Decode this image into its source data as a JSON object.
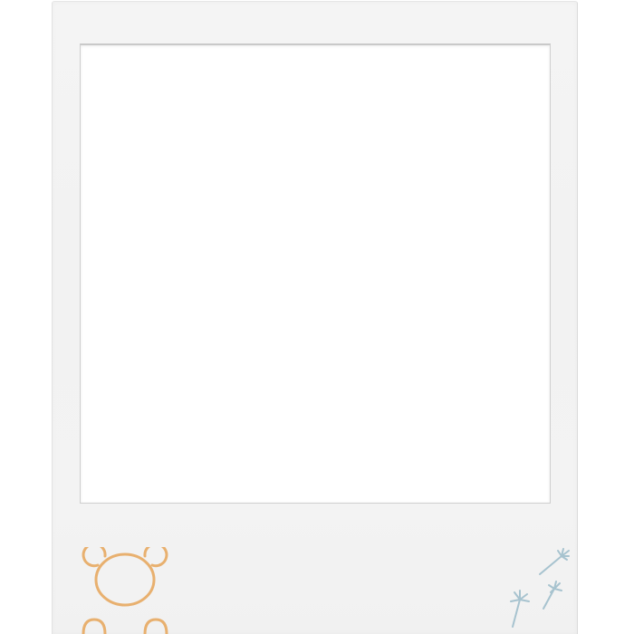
{
  "frame": {
    "style": "instant-photo-frame",
    "paper_color": "#f3f3f3",
    "window_color": "#ffffff"
  },
  "decorations": {
    "bear": {
      "icon": "teddy-bear-outline-icon",
      "stroke_color": "#e8b06f"
    },
    "dandelions": {
      "icon": "dandelion-seeds-icon",
      "stroke_color": "#a7c3cf"
    }
  }
}
